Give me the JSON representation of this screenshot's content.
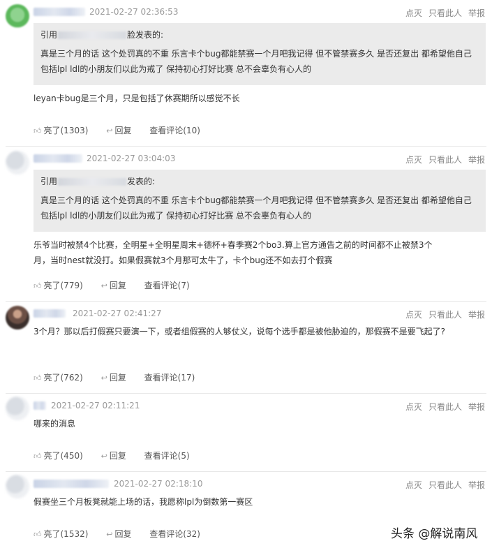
{
  "common": {
    "action_bury": "点灭",
    "action_only_this": "只看此人",
    "action_report": "举报",
    "like_prefix": "亮了",
    "reply_label": "回复",
    "view_comments_prefix": "查看评论",
    "quote_prefix": "引用",
    "quote_suffix": "发表的:",
    "quote_suffix_alt": "脸发表的:"
  },
  "comments": [
    {
      "time": "2021-02-27 02:36:53",
      "quote_head_suffix": "脸发表的:",
      "quote_text": "真是三个月的话 这个处罚真的不重 乐言卡个bug都能禁赛一个月吧我记得 但不管禁赛多久 是否还复出 都希望他自己包括lpl ldl的小朋友们以此为戒了 保持初心打好比赛 总不会辜负有心人的",
      "text": "leyan卡bug是三个月，只是包括了休赛期所以感觉不长",
      "likes": "亮了(1303)",
      "reply": "回复",
      "view": "查看评论(10)"
    },
    {
      "time": "2021-02-27 03:04:03",
      "quote_head_suffix": "发表的:",
      "quote_text": "真是三个月的话 这个处罚真的不重 乐言卡个bug都能禁赛一个月吧我记得 但不管禁赛多久 是否还复出 都希望他自己包括lpl ldl的小朋友们以此为戒了 保持初心打好比赛 总不会辜负有心人的",
      "text": "乐爷当时被禁4个比赛，全明星+全明星周末+德杯+春季赛2个bo3.算上官方通告之前的时间都不止被禁3个月，当时nest就没打。如果假赛就3个月那可太牛了，卡个bug还不如去打个假赛",
      "likes": "亮了(779)",
      "reply": "回复",
      "view": "查看评论(7)"
    },
    {
      "time": "2021-02-27 02:41:27",
      "text": "3个月？那以后打假赛只要演一下，或者组假赛的人够仗义，说每个选手都是被他胁迫的，那假赛不是要飞起了?",
      "likes": "亮了(762)",
      "reply": "回复",
      "view": "查看评论(17)"
    },
    {
      "time": "2021-02-27 02:11:21",
      "text": "哪来的消息",
      "likes": "亮了(450)",
      "reply": "回复",
      "view": "查看评论(5)"
    },
    {
      "time": "2021-02-27 02:18:10",
      "text": "假赛坐三个月板凳就能上场的话，我愿称lpl为倒数第一赛区",
      "likes": "亮了(1532)",
      "reply": "回复",
      "view": "查看评论(32)"
    }
  ],
  "watermark": "头条 @解说南风"
}
